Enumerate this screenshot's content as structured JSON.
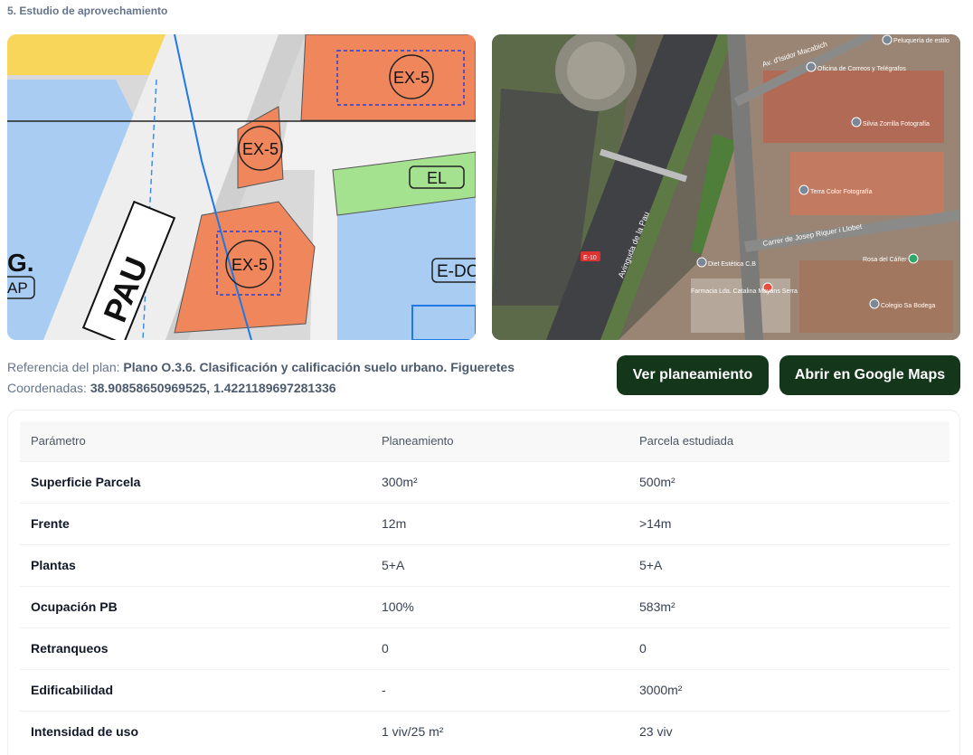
{
  "section": {
    "title": "5. Estudio de aprovechamiento"
  },
  "plan_map": {
    "labels": {
      "ex5_a": "EX-5",
      "ex5_b": "EX-5",
      "ex5_c": "EX-5",
      "el": "EL",
      "edo": "E-DO",
      "g": "G.",
      "ap": "AP",
      "pau": "PAU"
    }
  },
  "sat_map": {
    "labels": {
      "street1": "Av. d'Isidor Macabich",
      "street2": "Carrer de Josep Riquer i Llobet",
      "avenue": "Avinguda de la Pau",
      "road": "E-10",
      "poi1": "Oficina de Correos y Telégrafos",
      "poi2": "Silvia Zorrilla Fotografía",
      "poi3": "Terra Color Fotografía",
      "poi4": "Diet Estética C.B",
      "poi5": "Farmacia Lda. Catalina Mayans Serra",
      "poi6": "Rosa del Cáñer",
      "poi7": "Colegio Sa Bodega",
      "poi8": "Peluquería de estilo"
    }
  },
  "info": {
    "ref_label": "Referencia del plan:",
    "ref_value": "Plano O.3.6. Clasificación y calificación suelo urbano. Figueretes",
    "coord_label": "Coordenadas:",
    "coord_value": "38.90858650969525, 1.4221189697281336"
  },
  "buttons": {
    "plan": "Ver planeamiento",
    "maps": "Abrir en Google Maps"
  },
  "table": {
    "headers": [
      "Parámetro",
      "Planeamiento",
      "Parcela estudiada"
    ],
    "rows": [
      [
        "Superficie Parcela",
        "300m²",
        "500m²"
      ],
      [
        "Frente",
        "12m",
        ">14m"
      ],
      [
        "Plantas",
        "5+A",
        "5+A"
      ],
      [
        "Ocupación PB",
        "100%",
        "583m²"
      ],
      [
        "Retranqueos",
        "0",
        "0"
      ],
      [
        "Edificabilidad",
        "-",
        "3000m²"
      ],
      [
        "Intensidad de uso",
        "1 viv/25 m²",
        "23 viv"
      ]
    ]
  },
  "colors": {
    "button_bg": "#14361b",
    "plan_orange": "#f0865c",
    "plan_blue": "#a9cdf2",
    "plan_green": "#a5e290"
  }
}
